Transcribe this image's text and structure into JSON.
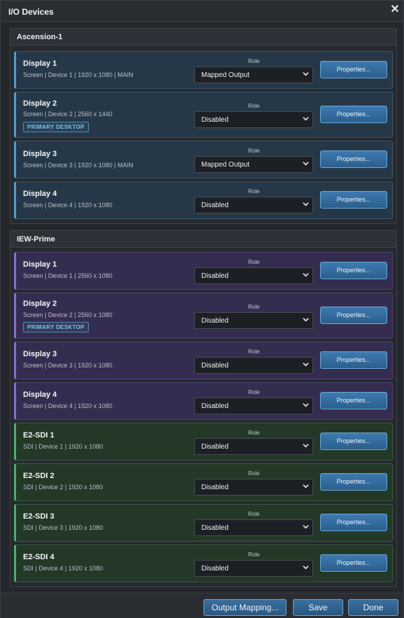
{
  "dialog": {
    "title": "I/O Devices"
  },
  "role_label": "Role",
  "properties_label": "Properties...",
  "badge_label": "PRIMARY DESKTOP",
  "groups": [
    {
      "title": "Ascension-1",
      "devices": [
        {
          "name": "Display 1",
          "info": "Screen | Device 1 | 1920 x 1080 | MAIN",
          "role": "Mapped Output"
        },
        {
          "name": "Display 2",
          "info": "Screen | Device 2 | 2560 x 1440",
          "role": "Disabled"
        },
        {
          "name": "Display 3",
          "info": "Screen | Device 3 | 1920 x 1080 | MAIN",
          "role": "Mapped Output"
        },
        {
          "name": "Display 4",
          "info": "Screen | Device 4 | 1920 x 1080",
          "role": "Disabled"
        }
      ]
    },
    {
      "title": "IEW-Prime",
      "devices": [
        {
          "name": "Display 1",
          "info": "Screen | Device 1 | 2560 x 1080",
          "role": "Disabled"
        },
        {
          "name": "Display 2",
          "info": "Screen | Device 2 | 2560 x 1080",
          "role": "Disabled"
        },
        {
          "name": "Display 3",
          "info": "Screen | Device 3 | 1920 x 1080",
          "role": "Disabled"
        },
        {
          "name": "Display 4",
          "info": "Screen | Device 4 | 1920 x 1080",
          "role": "Disabled"
        },
        {
          "name": "E2-SDI 1",
          "info": "SDI | Device 1 | 1920 x 1080",
          "role": "Disabled"
        },
        {
          "name": "E2-SDI 2",
          "info": "SDI | Device 2 | 1920 x 1080",
          "role": "Disabled"
        },
        {
          "name": "E2-SDI 3",
          "info": "SDI | Device 3 | 1920 x 1080",
          "role": "Disabled"
        },
        {
          "name": "E2-SDI 4",
          "info": "SDI | Device 4 | 1920 x 1080",
          "role": "Disabled"
        }
      ]
    }
  ],
  "footer": {
    "output_mapping_label": "Output Mapping...",
    "save_label": "Save",
    "done_label": "Done"
  },
  "icons": {
    "close": "close-icon",
    "chevron": "chevron-down-icon"
  },
  "colors": {
    "accent_blue": "#4f9bd0",
    "accent_purple": "#8a6ed6",
    "accent_green": "#49b266",
    "button_blue": "#2b5f8d"
  }
}
